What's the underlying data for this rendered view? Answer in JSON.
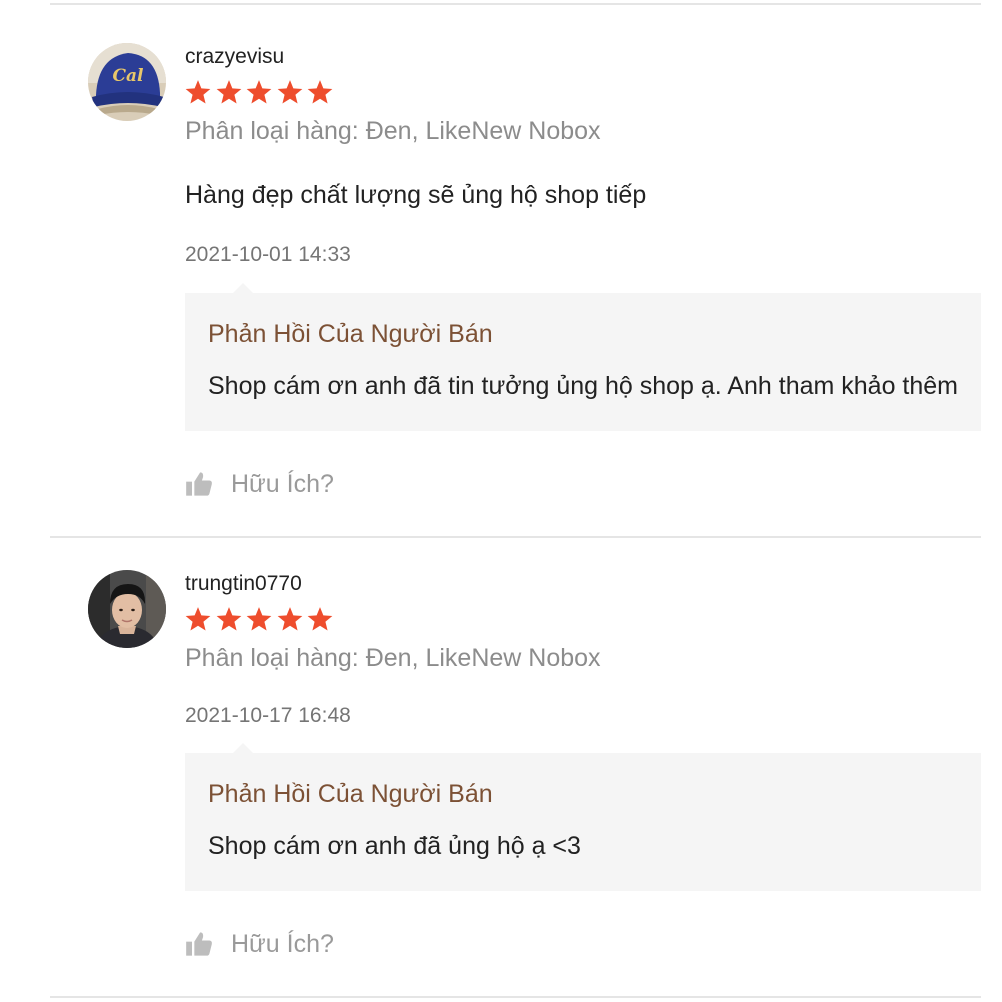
{
  "colors": {
    "star": "#ee4d2d",
    "seller_reply_title": "#7c5135",
    "muted_text": "#8c8c8c",
    "reply_background": "#f5f5f5",
    "divider": "#e5e5e5"
  },
  "reviews": [
    {
      "username": "crazyevisu",
      "rating": 5,
      "variant": "Phân loại hàng: Đen, LikeNew Nobox",
      "comment": "Hàng đẹp chất lượng sẽ ủng hộ shop tiếp",
      "timestamp": "2021-10-01 14:33",
      "avatar_icon": "cap-avatar",
      "seller_reply": {
        "title": "Phản Hồi Của Người Bán",
        "text": "Shop cám ơn anh đã tin tưởng ủng hộ shop ạ. Anh tham khảo thêm"
      },
      "helpful_label": "Hữu Ích?"
    },
    {
      "username": "trungtin0770",
      "rating": 5,
      "variant": "Phân loại hàng: Đen, LikeNew Nobox",
      "comment": "",
      "timestamp": "2021-10-17 16:48",
      "avatar_icon": "person-avatar",
      "seller_reply": {
        "title": "Phản Hồi Của Người Bán",
        "text": "Shop cám ơn anh đã ủng hộ ạ <3"
      },
      "helpful_label": "Hữu Ích?"
    }
  ]
}
